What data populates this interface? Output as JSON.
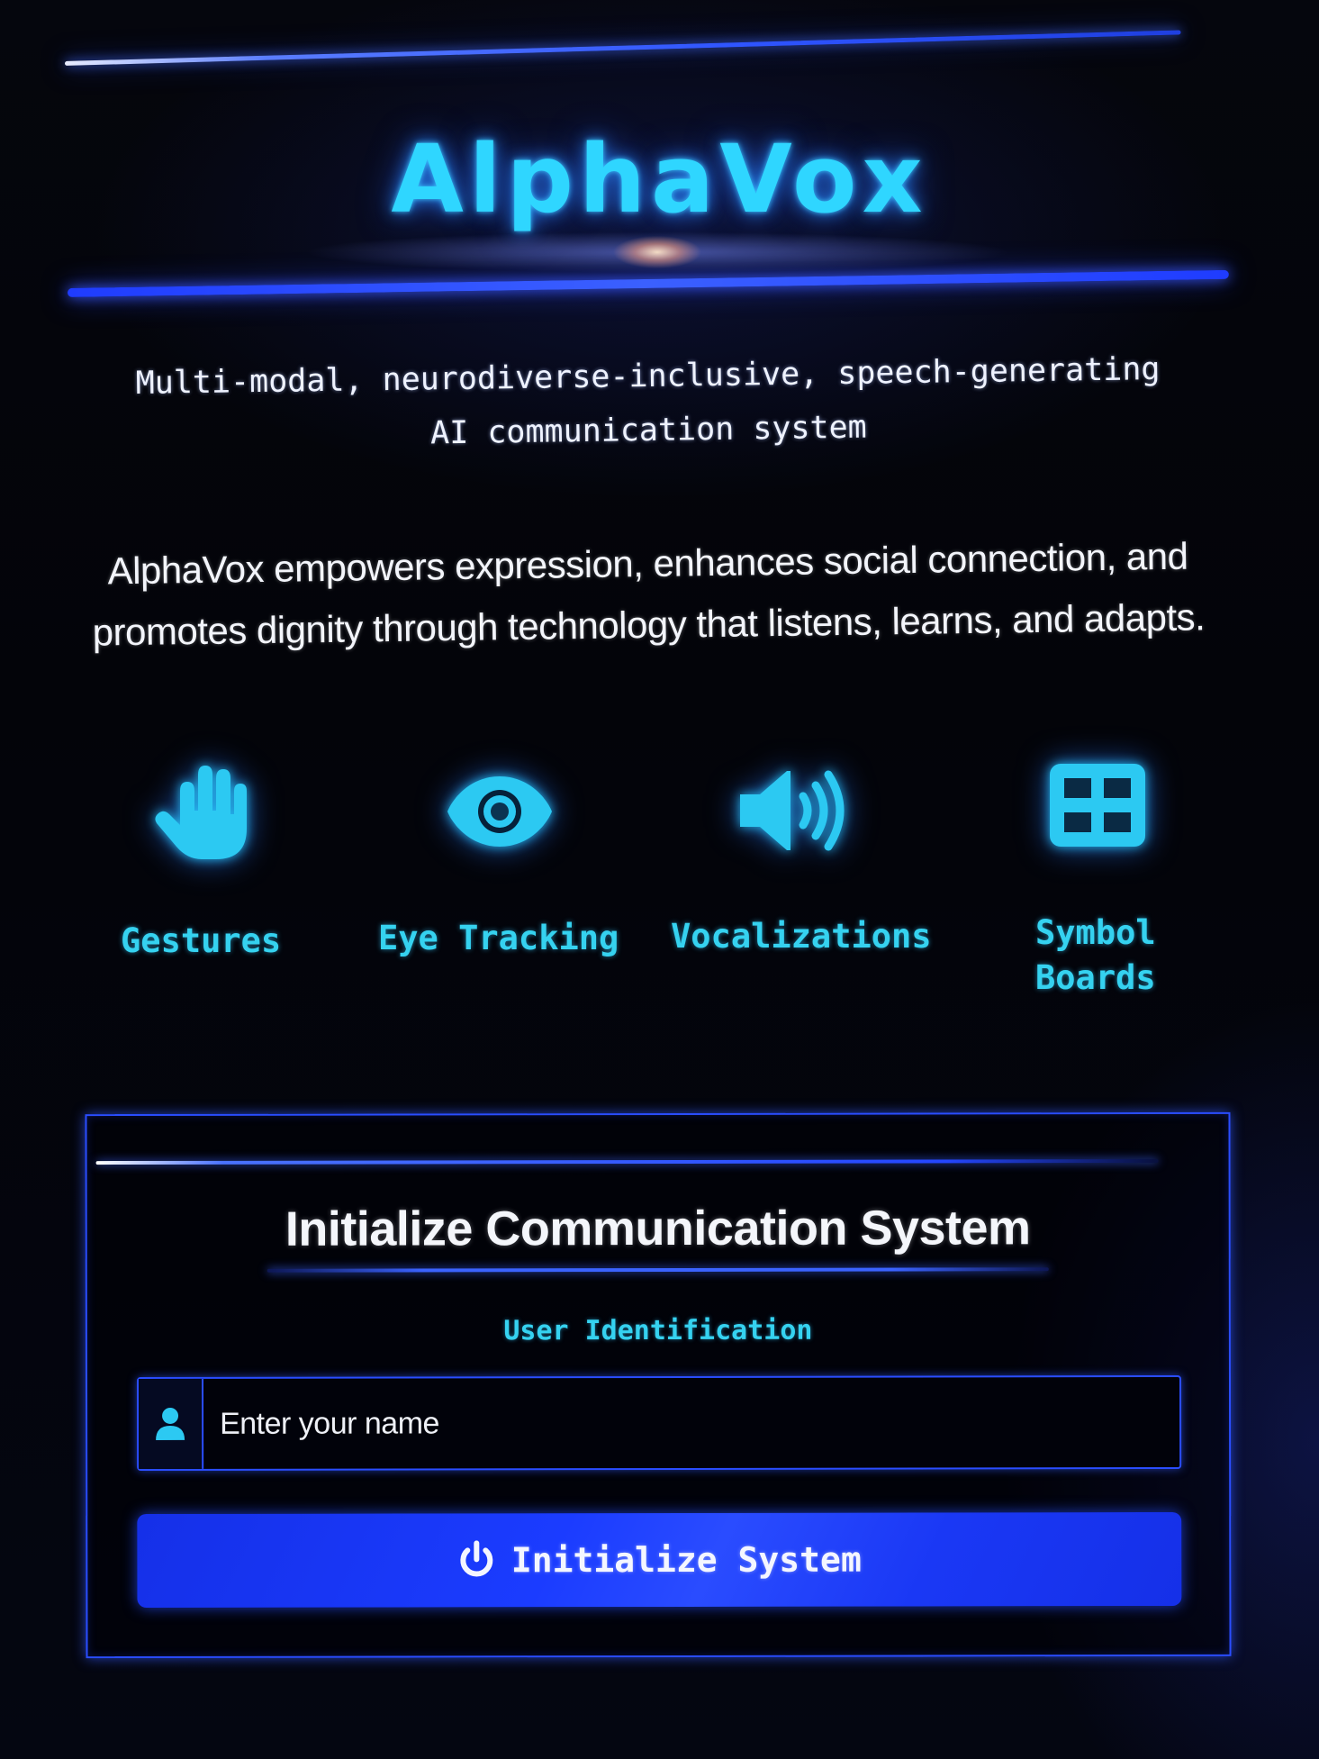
{
  "header": {
    "logo_text": "AlphaVox",
    "tagline_line1": "Multi-modal, neurodiverse-inclusive, speech-generating",
    "tagline_line2": "AI communication system",
    "mission": "AlphaVox empowers expression, enhances social connection, and promotes dignity through technology that listens, learns, and adapts."
  },
  "features": [
    {
      "label": "Gestures",
      "icon": "hand-icon"
    },
    {
      "label": "Eye Tracking",
      "icon": "eye-icon"
    },
    {
      "label": "Vocalizations",
      "icon": "speaker-icon"
    },
    {
      "label_line1": "Symbol",
      "label_line2": "Boards",
      "icon": "grid-icon"
    }
  ],
  "init_panel": {
    "title": "Initialize Communication System",
    "field_label": "User Identification",
    "name_placeholder": "Enter your name",
    "name_value": "",
    "user_icon": "user-icon",
    "button_icon": "power-icon",
    "button_label": "Initialize System"
  },
  "colors": {
    "background": "#03040a",
    "accent_cyan": "#35d2f0",
    "accent_blue": "#2a4dff",
    "button_blue": "#1b3cff",
    "text": "#f0f2f8"
  }
}
